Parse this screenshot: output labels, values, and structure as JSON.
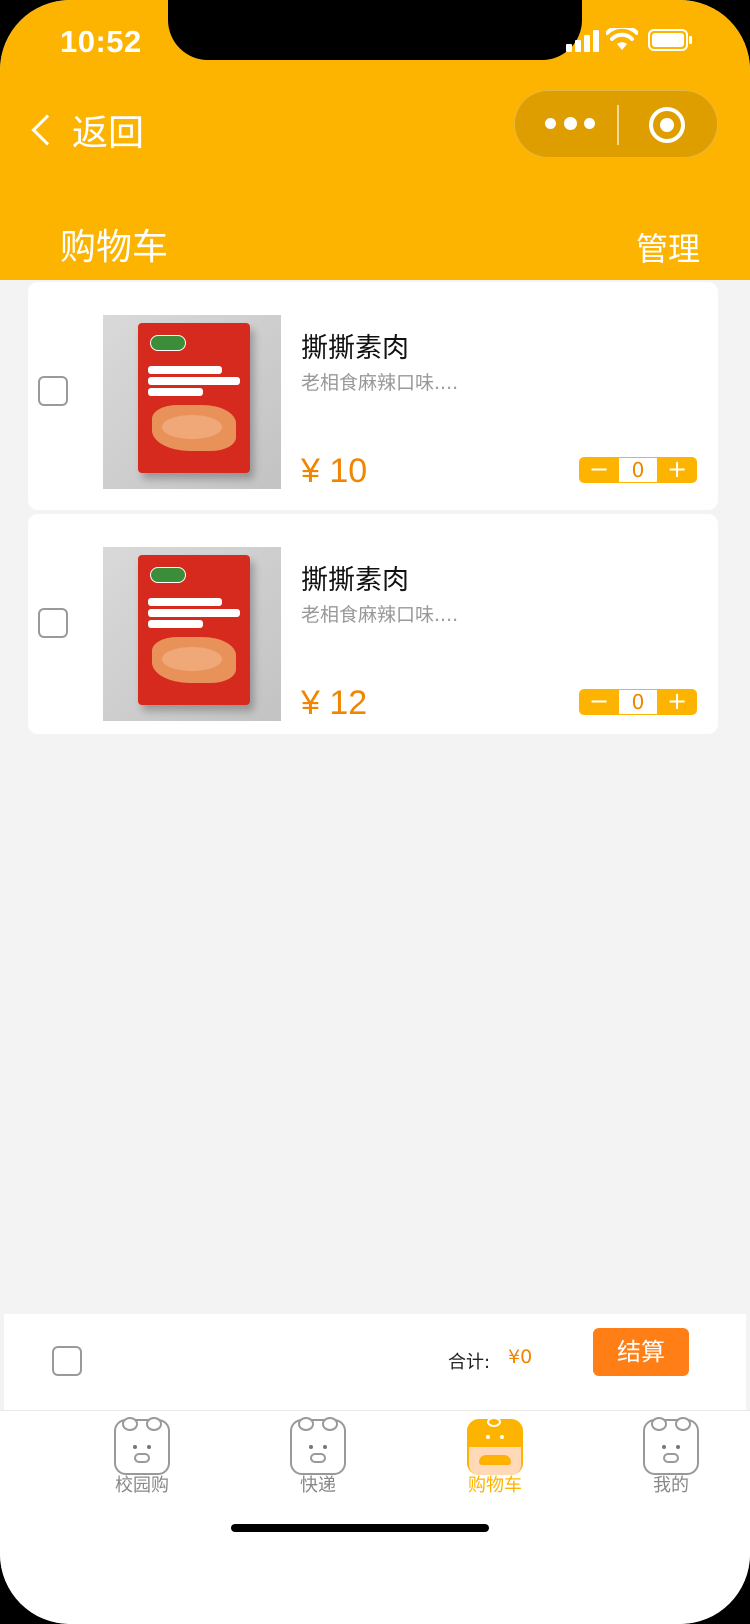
{
  "status_bar": {
    "time": "10:52"
  },
  "nav": {
    "back_label": "返回"
  },
  "header": {
    "title": "购物车",
    "manage_label": "管理"
  },
  "cart_items": [
    {
      "name": "撕撕素肉",
      "desc": "老相食麻辣口味....",
      "price": "¥ 10",
      "qty": "0"
    },
    {
      "name": "撕撕素肉",
      "desc": "老相食麻辣口味....",
      "price": "¥ 12",
      "qty": "0"
    }
  ],
  "stepper": {
    "minus": "−",
    "plus": "+"
  },
  "footer": {
    "total_label": "合计:",
    "total_value": "¥0",
    "checkout_label": "结算"
  },
  "tabs": [
    {
      "label": "校园购",
      "active": false
    },
    {
      "label": "快递",
      "active": false
    },
    {
      "label": "购物车",
      "active": true
    },
    {
      "label": "我的",
      "active": false
    }
  ],
  "colors": {
    "brand": "#FDB400",
    "price": "#F08500",
    "checkout": "#FF7F16",
    "background": "#F3F3F4"
  }
}
